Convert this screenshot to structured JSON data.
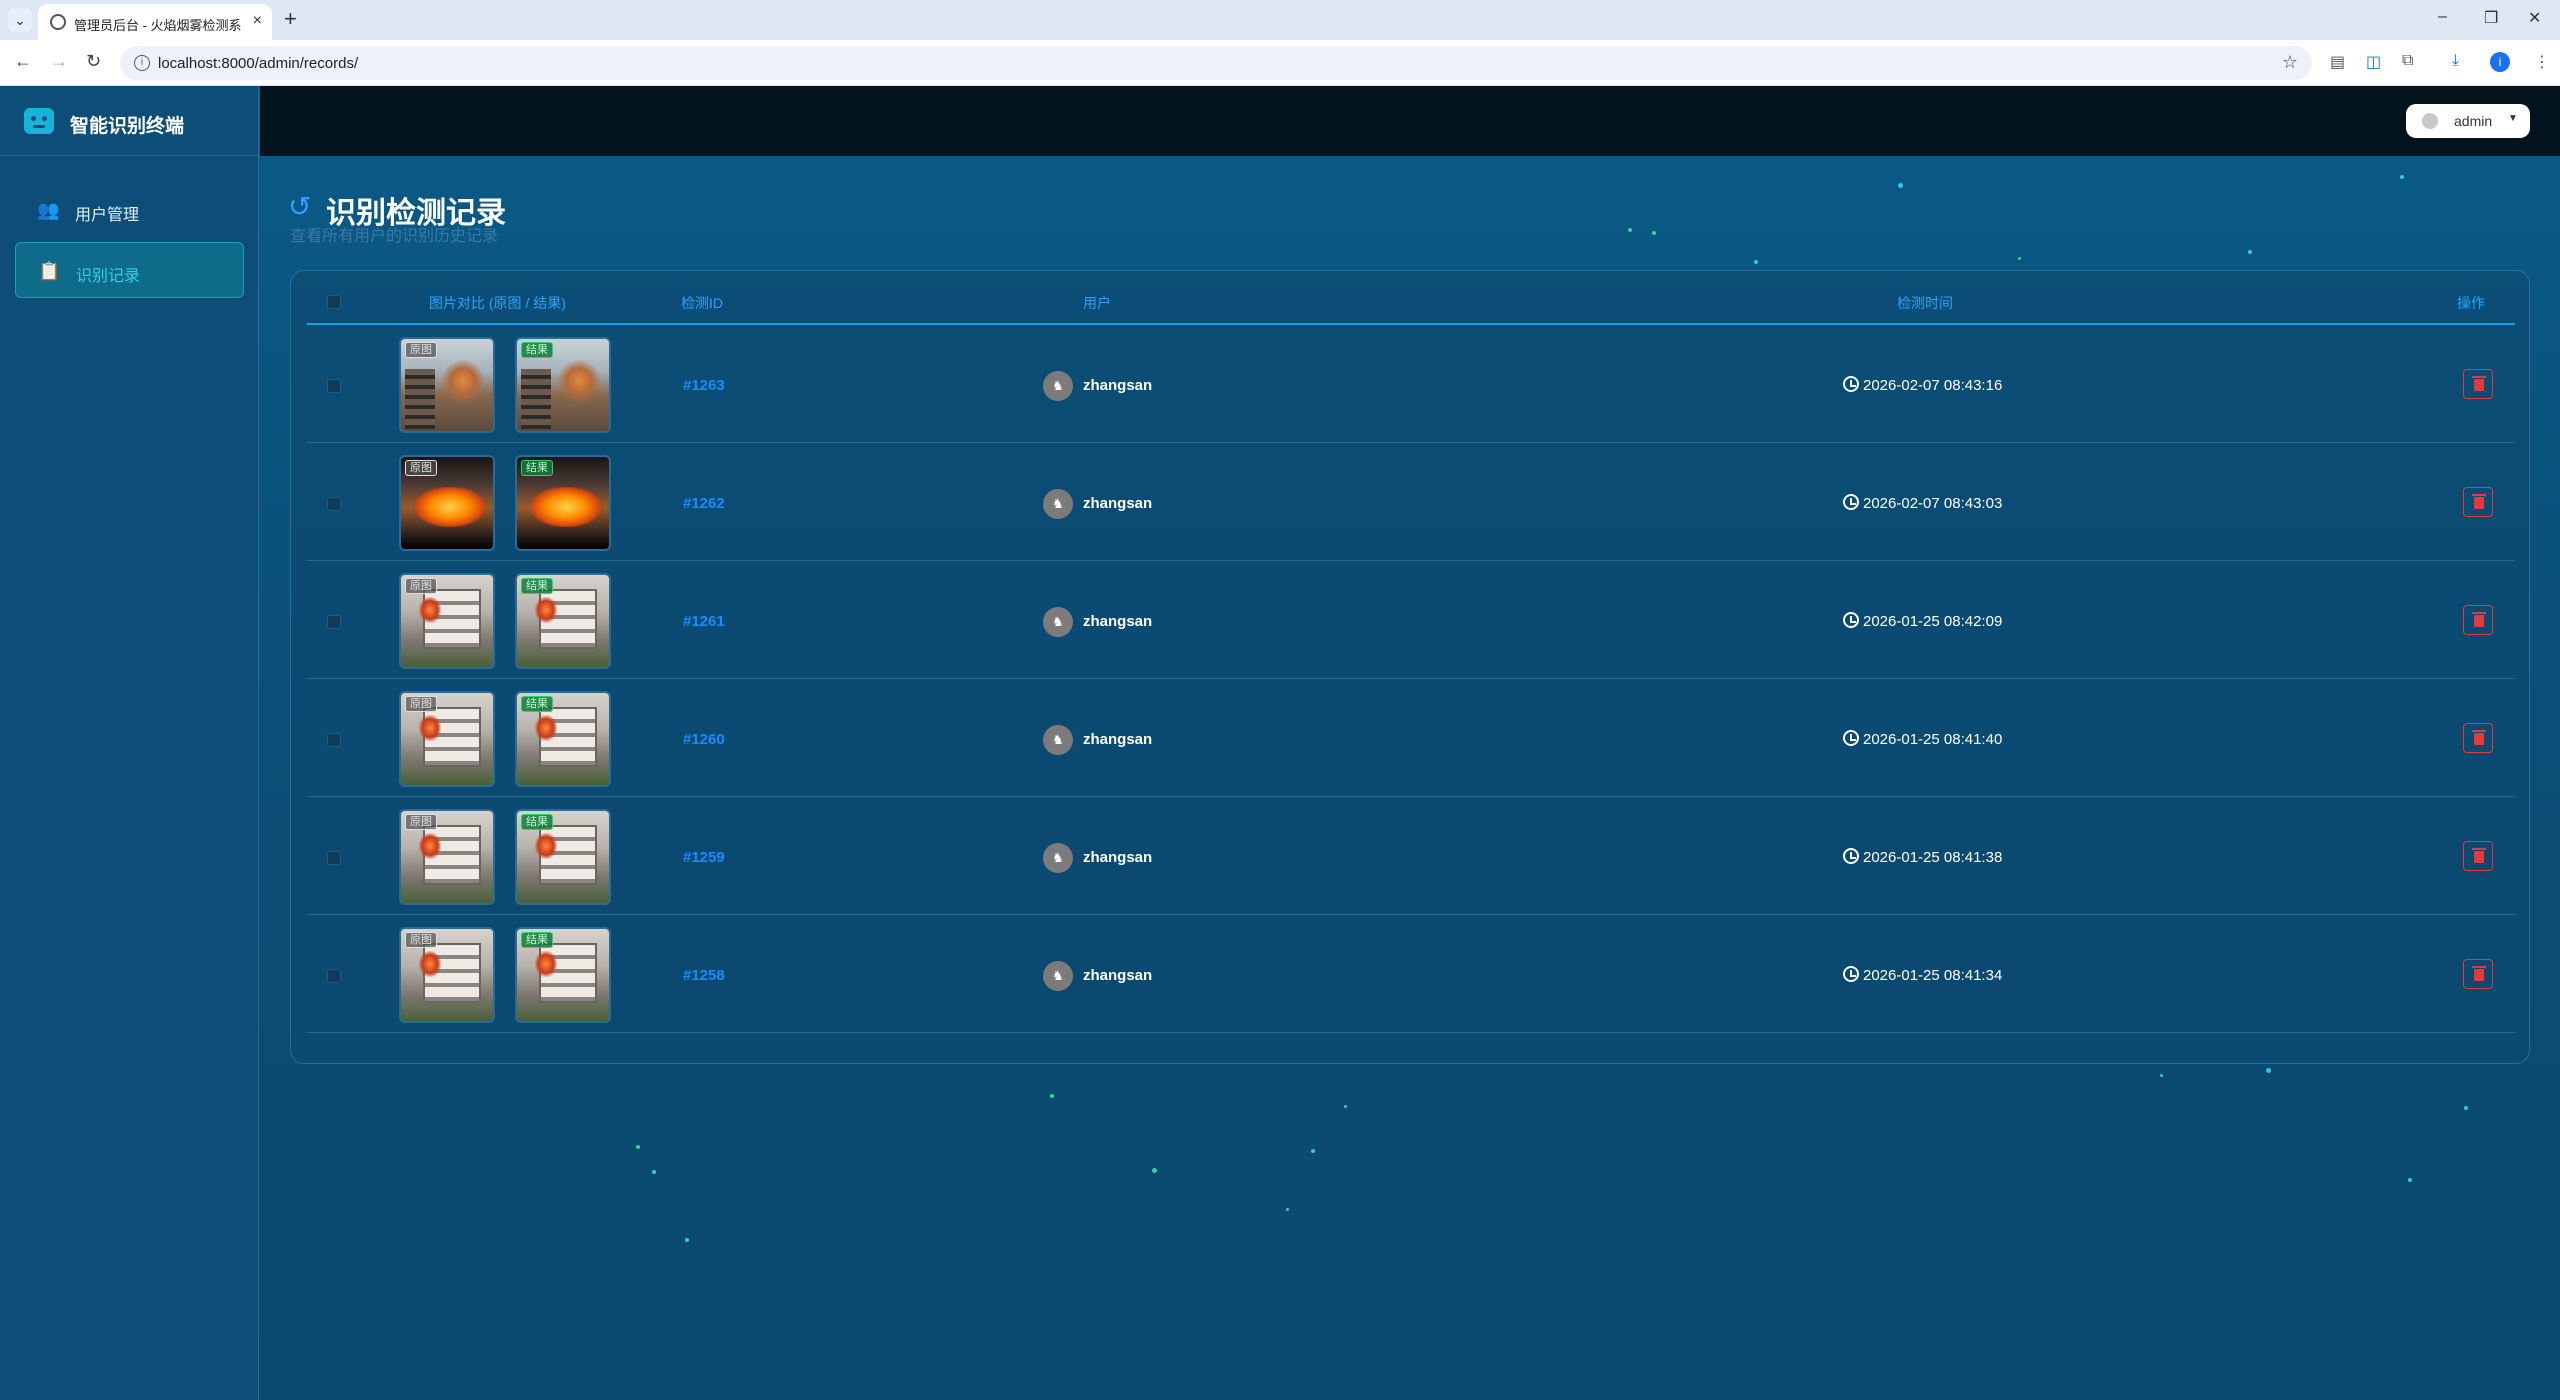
{
  "browser": {
    "tab_title": "管理员后台 - 火焰烟雾检测系统",
    "url": "localhost:8000/admin/records/",
    "profile_initial": "i"
  },
  "sidebar": {
    "brand": "智能识别终端",
    "items": [
      {
        "label": "用户管理",
        "icon": "users-icon",
        "active": false
      },
      {
        "label": "识别记录",
        "icon": "clipboard-icon",
        "active": true
      }
    ]
  },
  "topbar": {
    "user": "admin"
  },
  "page": {
    "title": "识别检测记录",
    "subtitle": "查看所有用户的识别历史记录"
  },
  "table": {
    "headers": {
      "images": "图片对比 (原图 / 结果)",
      "id": "检测ID",
      "user": "用户",
      "time": "检测时间",
      "actions": "操作"
    },
    "tag_original": "原图",
    "tag_result": "结果",
    "rows": [
      {
        "id": "#1263",
        "user": "zhangsan",
        "time": "2026-02-07 08:43:16",
        "image": "building-fire"
      },
      {
        "id": "#1262",
        "user": "zhangsan",
        "time": "2026-02-07 08:43:03",
        "image": "ground-fire"
      },
      {
        "id": "#1261",
        "user": "zhangsan",
        "time": "2026-01-25 08:42:09",
        "image": "house-fire"
      },
      {
        "id": "#1260",
        "user": "zhangsan",
        "time": "2026-01-25 08:41:40",
        "image": "house-fire"
      },
      {
        "id": "#1259",
        "user": "zhangsan",
        "time": "2026-01-25 08:41:38",
        "image": "house-fire"
      },
      {
        "id": "#1258",
        "user": "zhangsan",
        "time": "2026-01-25 08:41:34",
        "image": "house-fire"
      }
    ]
  },
  "colors": {
    "accent": "#2aa3ff",
    "result_tag": "#32d26a",
    "delete": "#e53a3a",
    "sidebar_active": "#31d1e6"
  }
}
